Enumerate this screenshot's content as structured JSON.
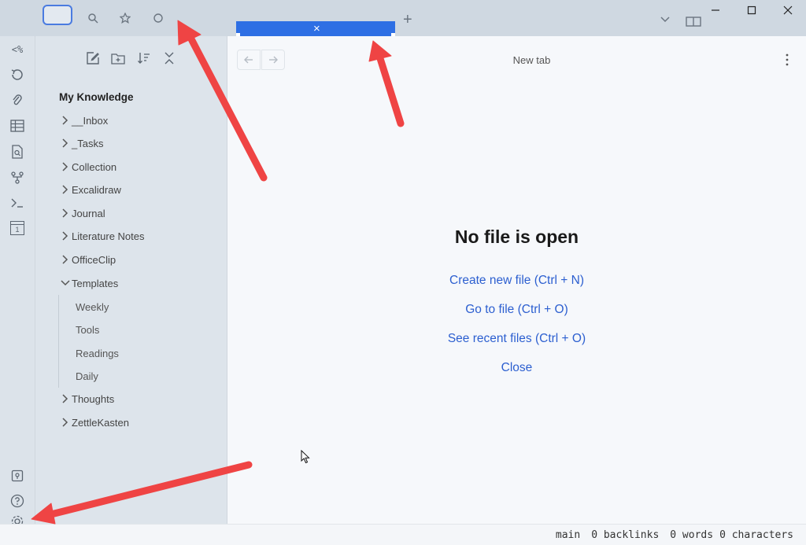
{
  "titlebar": {
    "icons": [
      "files-icon",
      "search-icon",
      "bookmark-icon",
      "graph-icon"
    ],
    "active_tab_close": "×",
    "new_tab": "+"
  },
  "ribbon": {
    "top_icons": [
      "templater-icon",
      "history-icon",
      "attachment-icon",
      "table-icon",
      "file-search-icon",
      "git-icon",
      "terminal-icon",
      "calendar-icon"
    ],
    "bottom_icons": [
      "vault-icon",
      "help-icon",
      "settings-icon"
    ],
    "templater_glyph": "<%",
    "calendar_day": "1"
  },
  "sidebar": {
    "toolbar": [
      "new-note-icon",
      "new-folder-icon",
      "sort-icon",
      "collapse-all-icon"
    ],
    "vault_name": "My Knowledge",
    "folders": [
      {
        "label": "__Inbox",
        "expanded": false
      },
      {
        "label": "_Tasks",
        "expanded": false
      },
      {
        "label": "Collection",
        "expanded": false
      },
      {
        "label": "Excalidraw",
        "expanded": false
      },
      {
        "label": "Journal",
        "expanded": false
      },
      {
        "label": "Literature Notes",
        "expanded": false
      },
      {
        "label": "OfficeClip",
        "expanded": false
      },
      {
        "label": "Templates",
        "expanded": true
      },
      {
        "label": "Thoughts",
        "expanded": false
      },
      {
        "label": "ZettleKasten",
        "expanded": false
      }
    ],
    "template_files": [
      "Weekly",
      "Tools",
      "Readings",
      "Daily"
    ]
  },
  "main": {
    "tab_title": "New tab",
    "empty_title": "No file is open",
    "actions": [
      "Create new file (Ctrl + N)",
      "Go to file (Ctrl + O)",
      "See recent files (Ctrl + O)",
      "Close"
    ]
  },
  "statusbar": {
    "branch": "main",
    "backlinks": "0 backlinks",
    "words": "0 words",
    "characters": "0 characters"
  },
  "colors": {
    "accent": "#2e6fe4",
    "link": "#2c5fd0",
    "annotation_arrow": "#ef4444"
  }
}
